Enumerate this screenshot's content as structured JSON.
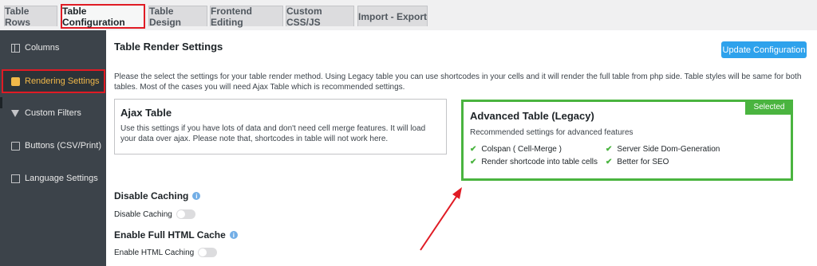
{
  "tabs": [
    {
      "label": "Table Rows"
    },
    {
      "label": "Table Configuration"
    },
    {
      "label": "Table Design"
    },
    {
      "label": "Frontend Editing"
    },
    {
      "label": "Custom CSS/JS"
    },
    {
      "label": "Import - Export"
    }
  ],
  "sidebar": {
    "items": [
      {
        "label": "Columns",
        "icon": "columns-icon"
      },
      {
        "label": "Rendering Settings",
        "icon": "render-icon"
      },
      {
        "label": "Custom Filters",
        "icon": "filter-icon"
      },
      {
        "label": "Buttons (CSV/Print)",
        "icon": "buttons-icon"
      },
      {
        "label": "Language Settings",
        "icon": "language-icon"
      }
    ]
  },
  "main": {
    "title": "Table Render Settings",
    "update_button": "Update Configuration",
    "intro": "Please the select the settings for your table render method. Using Legacy table you can use shortcodes in your cells and it will render the full table from php side. Table styles will be same for both tables. Most of the cases you will need Ajax Table which is recommended settings.",
    "ajax_card": {
      "title": "Ajax Table",
      "text": "Use this settings if you have lots of data and don't need cell merge features. It will load your data over ajax. Please note that, shortcodes in table will not work here."
    },
    "legacy_card": {
      "title": "Advanced Table (Legacy)",
      "badge": "Selected",
      "subtitle": "Recommended settings for advanced features",
      "features": [
        "Colspan ( Cell-Merge )",
        "Server Side Dom-Generation",
        "Render shortcode into table cells",
        "Better for SEO"
      ]
    },
    "disable_caching": {
      "title": "Disable Caching",
      "toggle_label": "Disable Caching",
      "enabled": false
    },
    "html_cache": {
      "title": "Enable Full HTML Cache",
      "toggle_label": "Enable HTML Caching",
      "enabled": false
    }
  },
  "colors": {
    "accent": "#2ea2ec",
    "selected": "#4ab43f",
    "highlight": "#e01b24",
    "sidebar": "#3c434a",
    "active_text": "#f0b849"
  }
}
